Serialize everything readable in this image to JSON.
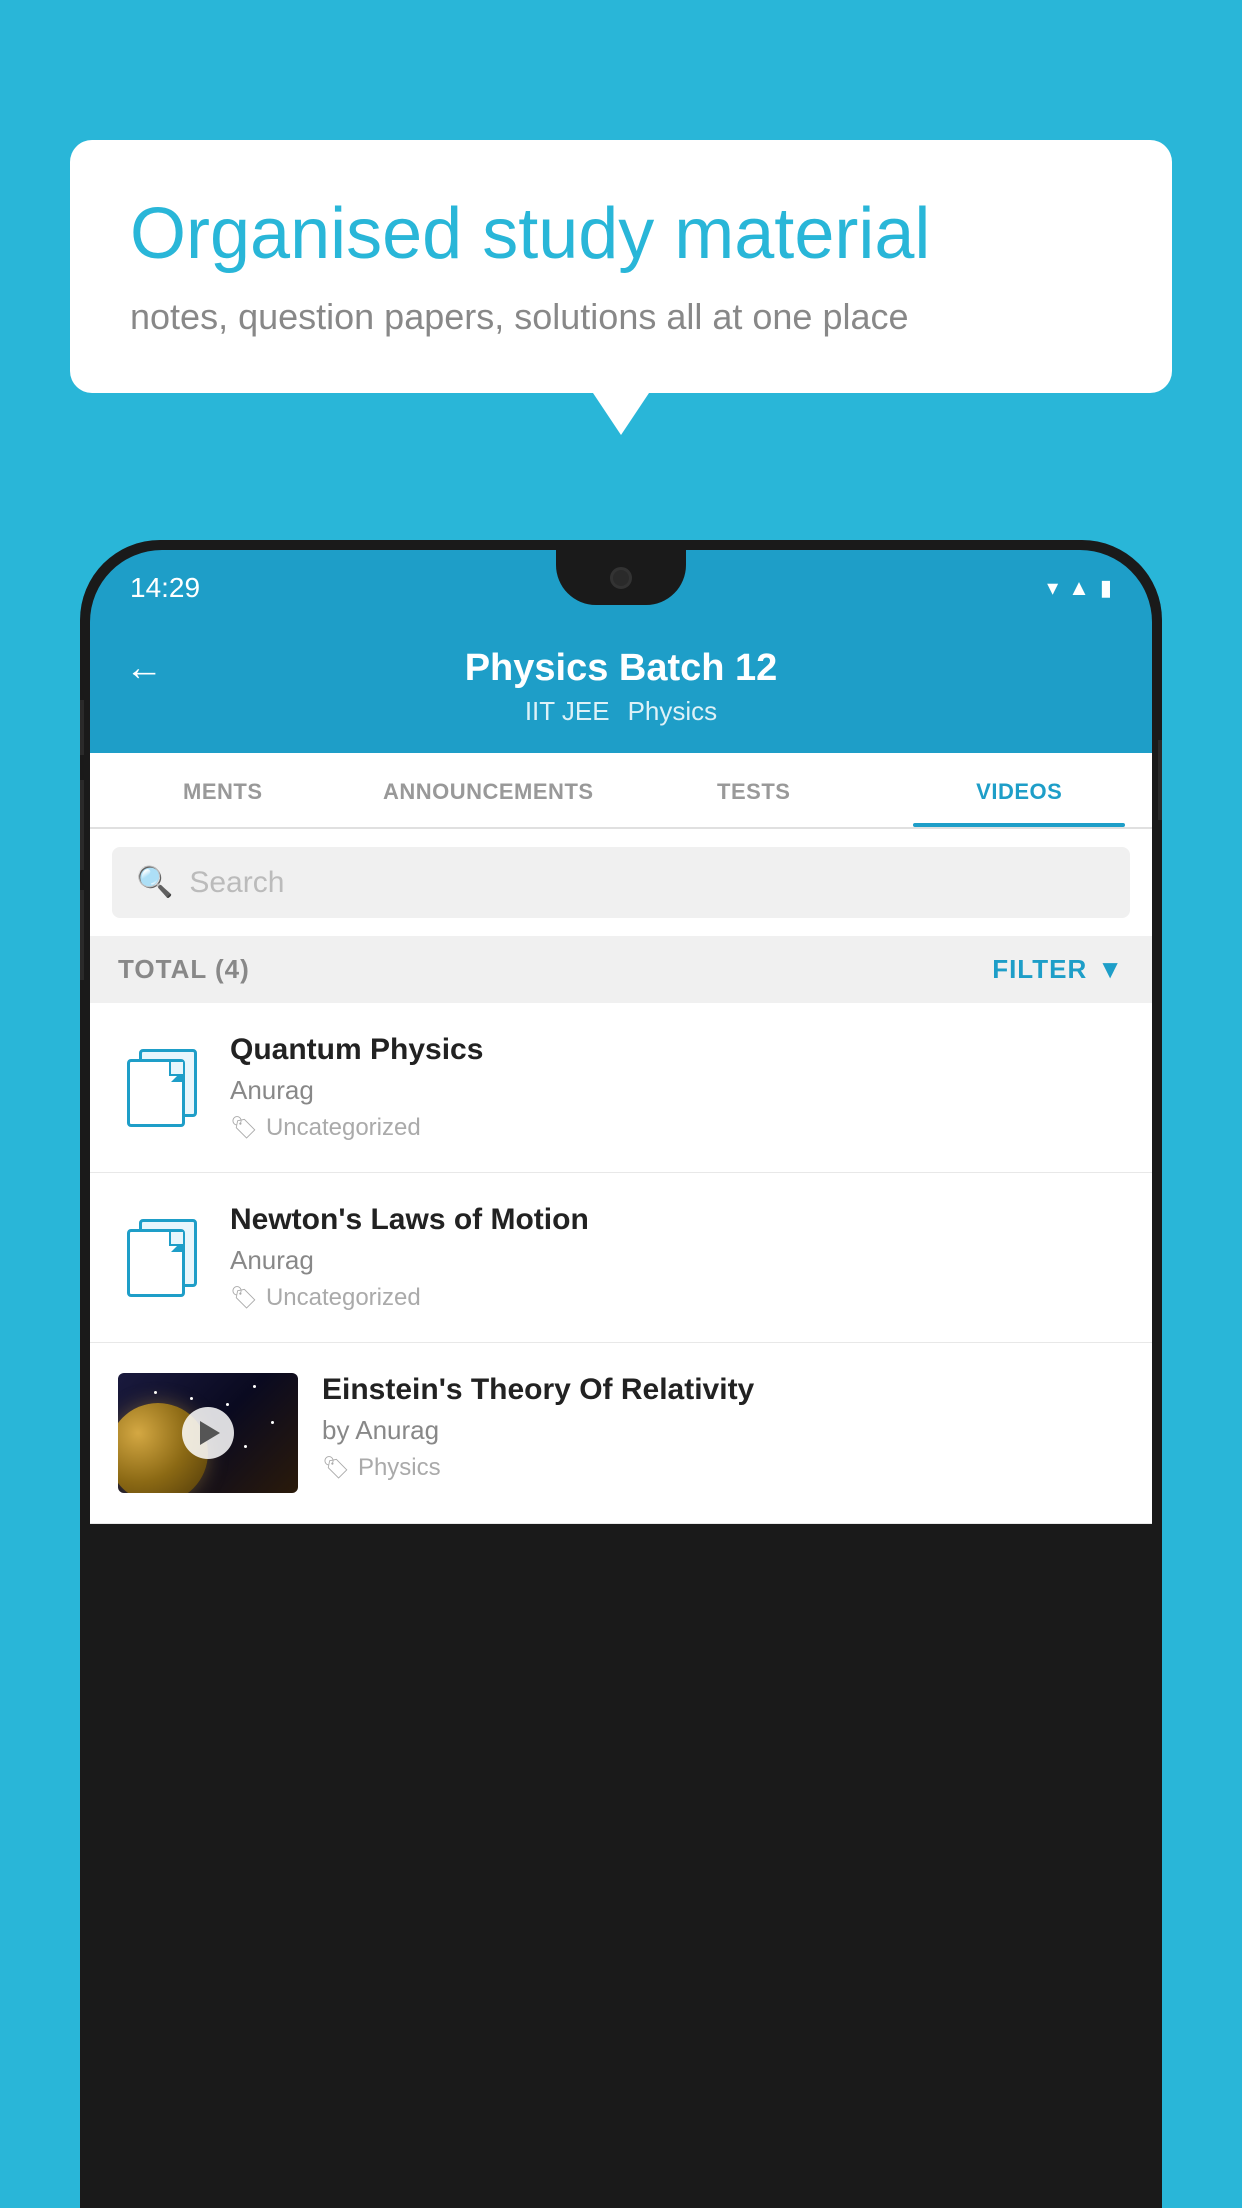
{
  "background_color": "#29b6d8",
  "speech_bubble": {
    "title": "Organised study material",
    "subtitle": "notes, question papers, solutions all at one place"
  },
  "phone": {
    "status_bar": {
      "time": "14:29",
      "icons": [
        "wifi",
        "signal",
        "battery"
      ]
    },
    "header": {
      "back_label": "←",
      "title": "Physics Batch 12",
      "subtitle1": "IIT JEE",
      "subtitle2": "Physics"
    },
    "tabs": [
      {
        "label": "MENTS",
        "active": false
      },
      {
        "label": "ANNOUNCEMENTS",
        "active": false
      },
      {
        "label": "TESTS",
        "active": false
      },
      {
        "label": "VIDEOS",
        "active": true
      }
    ],
    "search": {
      "placeholder": "Search"
    },
    "filter": {
      "total_label": "TOTAL (4)",
      "filter_label": "FILTER"
    },
    "videos": [
      {
        "id": 1,
        "title": "Quantum Physics",
        "author": "Anurag",
        "tag": "Uncategorized",
        "has_thumbnail": false
      },
      {
        "id": 2,
        "title": "Newton's Laws of Motion",
        "author": "Anurag",
        "tag": "Uncategorized",
        "has_thumbnail": false
      },
      {
        "id": 3,
        "title": "Einstein's Theory Of Relativity",
        "author": "by Anurag",
        "tag": "Physics",
        "has_thumbnail": true
      }
    ]
  }
}
